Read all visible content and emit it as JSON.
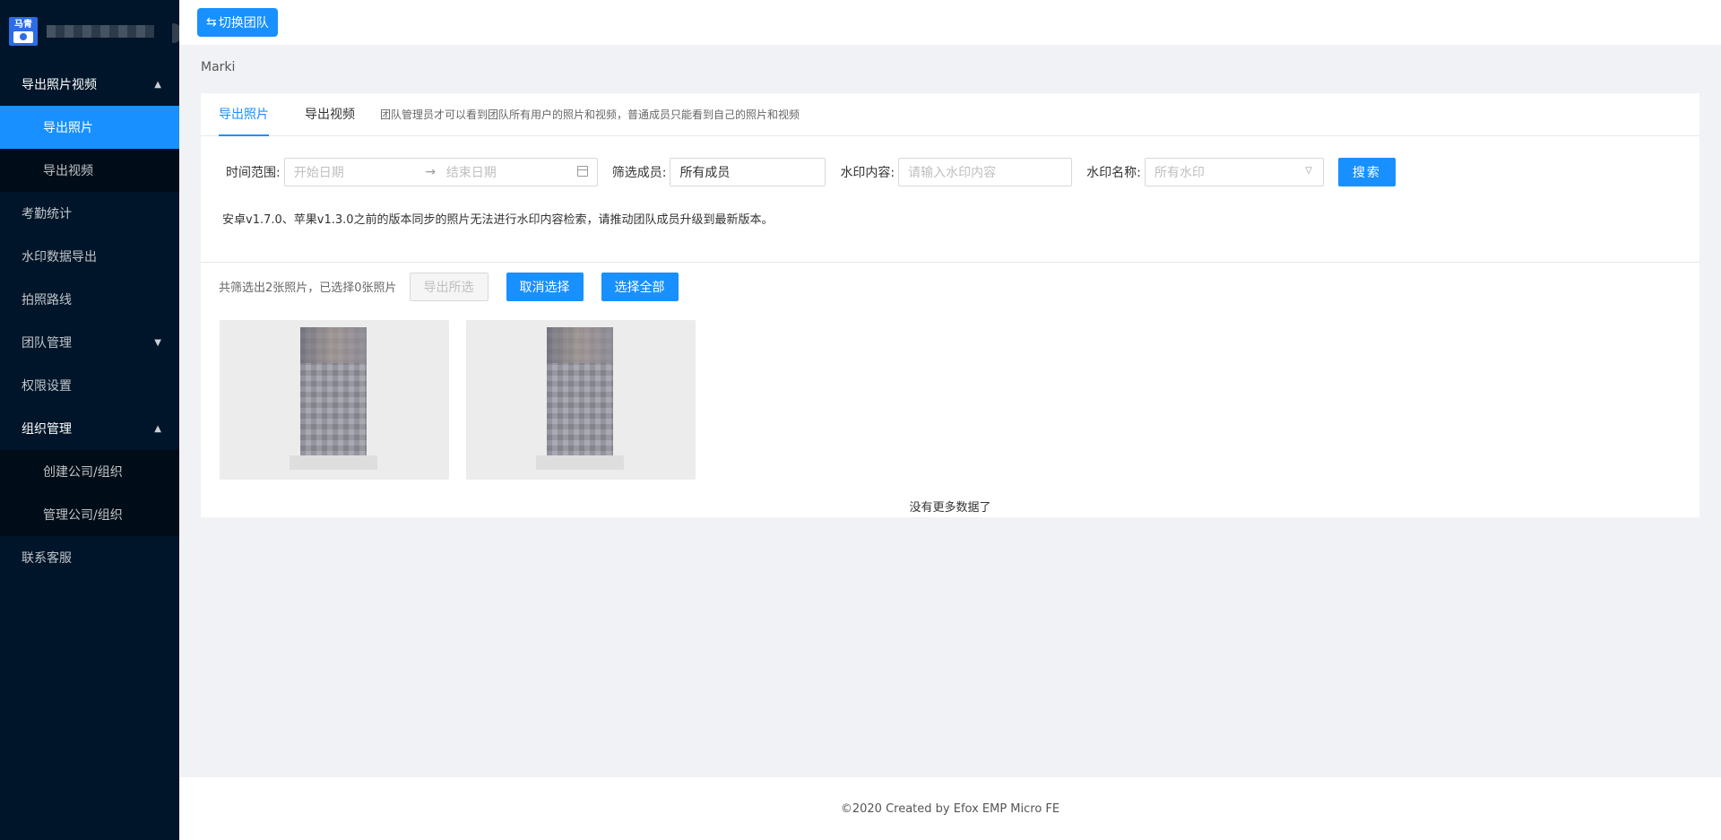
{
  "header": {
    "switch_team_label": "切换团队",
    "switch_icon": "swap-icon"
  },
  "sidebar": {
    "menu": [
      {
        "label": "导出照片视频",
        "expanded": true,
        "children": [
          {
            "label": "导出照片",
            "active": true
          },
          {
            "label": "导出视频"
          }
        ]
      },
      {
        "label": "考勤统计"
      },
      {
        "label": "水印数据导出"
      },
      {
        "label": "拍照路线"
      },
      {
        "label": "团队管理",
        "expanded": false
      },
      {
        "label": "权限设置"
      },
      {
        "label": "组织管理",
        "expanded": true,
        "children": [
          {
            "label": "创建公司/组织"
          },
          {
            "label": "管理公司/组织"
          }
        ]
      },
      {
        "label": "联系客服"
      }
    ],
    "logo_text": "马青"
  },
  "breadcrumb": "Marki",
  "tabs": {
    "items": [
      "导出照片",
      "导出视频"
    ],
    "tip": "团队管理员才可以看到团队所有用户的照片和视频，普通成员只能看到自己的照片和视频"
  },
  "filters": {
    "time_label": "时间范围:",
    "start_placeholder": "开始日期",
    "end_placeholder": "结束日期",
    "member_label": "筛选成员:",
    "member_value": "所有成员",
    "watermark_content_label": "水印内容:",
    "watermark_content_placeholder": "请输入水印内容",
    "watermark_name_label": "水印名称:",
    "watermark_name_placeholder": "所有水印",
    "search_label": "搜索"
  },
  "notice": "安卓v1.7.0、苹果v1.3.0之前的版本同步的照片无法进行水印内容检索，请推动团队成员升级到最新版本。",
  "toolbar": {
    "count_text": "共筛选出2张照片，已选择0张照片",
    "export_selected": "导出所选",
    "cancel_selection": "取消选择",
    "select_all": "选择全部"
  },
  "photos_count": 2,
  "no_more": "没有更多数据了",
  "footer": "©2020 Created by Efox EMP Micro FE",
  "colors": {
    "primary": "#1890ff",
    "sidebar_bg": "#001529",
    "submenu_bg": "#000c17"
  }
}
